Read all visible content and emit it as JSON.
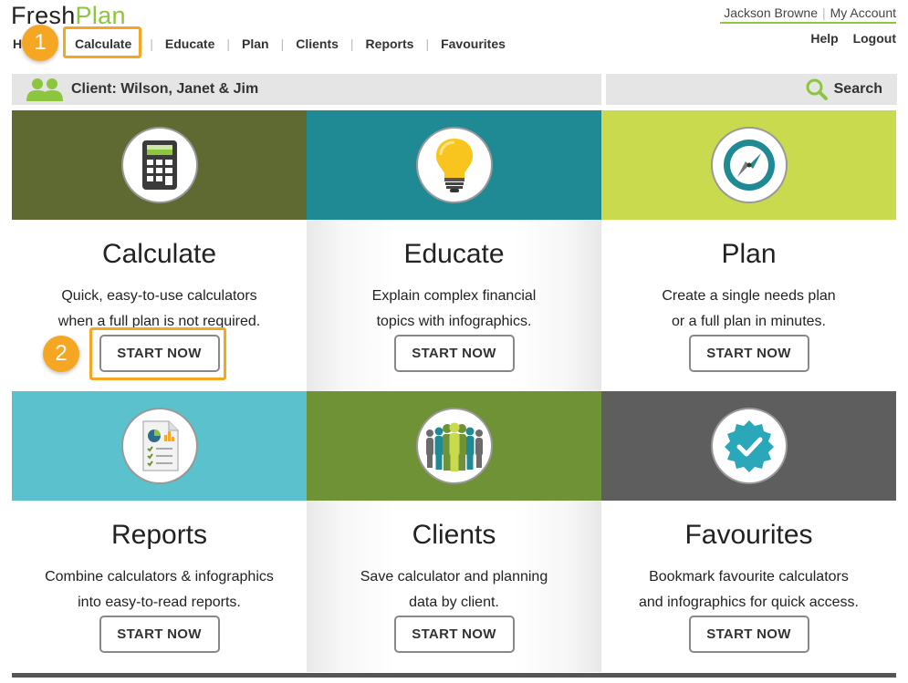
{
  "brand": {
    "fresh": "Fresh",
    "plan": "Plan"
  },
  "topnav": {
    "home": "Home",
    "calculate": "Calculate",
    "educate": "Educate",
    "plan": "Plan",
    "clients": "Clients",
    "reports": "Reports",
    "favourites": "Favourites",
    "separator": "|"
  },
  "user": {
    "name": "Jackson Browne",
    "account": "My Account",
    "help": "Help",
    "logout": "Logout",
    "separator": "|"
  },
  "annotations": {
    "step1": "1",
    "step2": "2"
  },
  "client": {
    "label": "Client: Wilson, Janet & Jim"
  },
  "search": {
    "label": "Search"
  },
  "tiles": [
    {
      "title": "Calculate",
      "line1": "Quick, easy-to-use calculators",
      "line2": "when a full plan is not required.",
      "button": "START NOW",
      "icon": "calculator-icon",
      "color": "#5f6a32"
    },
    {
      "title": "Educate",
      "line1": "Explain complex financial",
      "line2": "topics with infographics.",
      "button": "START NOW",
      "icon": "lightbulb-icon",
      "color": "#1f8a93"
    },
    {
      "title": "Plan",
      "line1": "Create a single needs plan",
      "line2": "or a full plan in minutes.",
      "button": "START NOW",
      "icon": "compass-icon",
      "color": "#c9da4f"
    },
    {
      "title": "Reports",
      "line1": "Combine calculators & infographics",
      "line2": "into easy-to-read reports.",
      "button": "START NOW",
      "icon": "report-icon",
      "color": "#5bc1cc"
    },
    {
      "title": "Clients",
      "line1": "Save calculator and planning",
      "line2": "data by client.",
      "button": "START NOW",
      "icon": "people-group-icon",
      "color": "#6f9237"
    },
    {
      "title": "Favourites",
      "line1": "Bookmark favourite calculators",
      "line2": "and infographics for quick access.",
      "button": "START NOW",
      "icon": "verified-badge-icon",
      "color": "#5e5e5e"
    }
  ],
  "colors": {
    "accent": "#8cc63f",
    "highlight": "#f5a623"
  }
}
